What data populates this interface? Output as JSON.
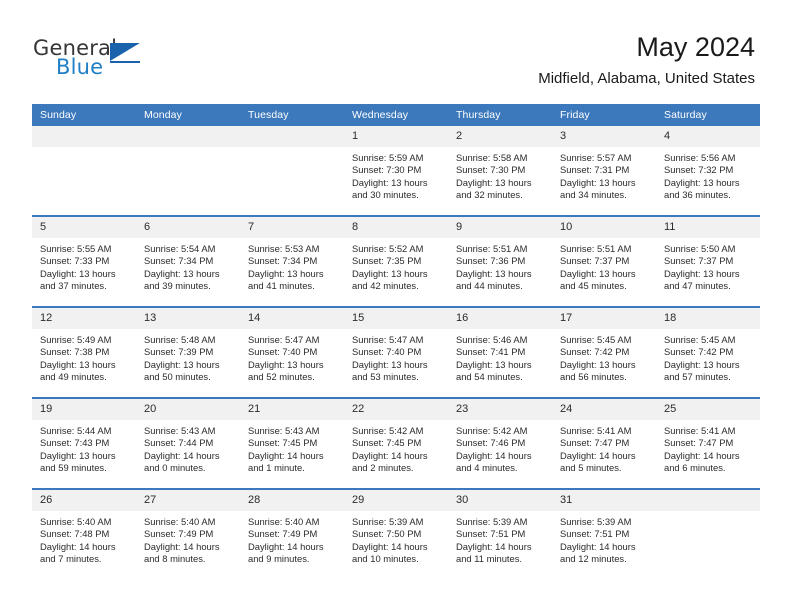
{
  "logo": {
    "word_one": "General",
    "word_two": "Blue",
    "triangle_icon": "triangle-icon",
    "accent_color": "#1b62ad"
  },
  "header": {
    "title": "May 2024",
    "subtitle": "Midfield, Alabama, United States"
  },
  "theme": {
    "header_blue": "#3c78bc",
    "daynum_gray": "#f1f1f1"
  },
  "calendar": {
    "weekday_headers": [
      "Sunday",
      "Monday",
      "Tuesday",
      "Wednesday",
      "Thursday",
      "Friday",
      "Saturday"
    ],
    "labels": {
      "sunrise": "Sunrise:",
      "sunset": "Sunset:",
      "daylight": "Daylight:"
    },
    "weeks": [
      [
        {
          "day": "",
          "blank": true,
          "sunrise": "",
          "sunset": "",
          "daylight_line1": "",
          "daylight_line2": ""
        },
        {
          "day": "",
          "blank": true,
          "sunrise": "",
          "sunset": "",
          "daylight_line1": "",
          "daylight_line2": ""
        },
        {
          "day": "",
          "blank": true,
          "sunrise": "",
          "sunset": "",
          "daylight_line1": "",
          "daylight_line2": ""
        },
        {
          "day": "1",
          "sunrise": "Sunrise: 5:59 AM",
          "sunset": "Sunset: 7:30 PM",
          "daylight_line1": "Daylight: 13 hours",
          "daylight_line2": "and 30 minutes."
        },
        {
          "day": "2",
          "sunrise": "Sunrise: 5:58 AM",
          "sunset": "Sunset: 7:30 PM",
          "daylight_line1": "Daylight: 13 hours",
          "daylight_line2": "and 32 minutes."
        },
        {
          "day": "3",
          "sunrise": "Sunrise: 5:57 AM",
          "sunset": "Sunset: 7:31 PM",
          "daylight_line1": "Daylight: 13 hours",
          "daylight_line2": "and 34 minutes."
        },
        {
          "day": "4",
          "sunrise": "Sunrise: 5:56 AM",
          "sunset": "Sunset: 7:32 PM",
          "daylight_line1": "Daylight: 13 hours",
          "daylight_line2": "and 36 minutes."
        }
      ],
      [
        {
          "day": "5",
          "sunrise": "Sunrise: 5:55 AM",
          "sunset": "Sunset: 7:33 PM",
          "daylight_line1": "Daylight: 13 hours",
          "daylight_line2": "and 37 minutes."
        },
        {
          "day": "6",
          "sunrise": "Sunrise: 5:54 AM",
          "sunset": "Sunset: 7:34 PM",
          "daylight_line1": "Daylight: 13 hours",
          "daylight_line2": "and 39 minutes."
        },
        {
          "day": "7",
          "sunrise": "Sunrise: 5:53 AM",
          "sunset": "Sunset: 7:34 PM",
          "daylight_line1": "Daylight: 13 hours",
          "daylight_line2": "and 41 minutes."
        },
        {
          "day": "8",
          "sunrise": "Sunrise: 5:52 AM",
          "sunset": "Sunset: 7:35 PM",
          "daylight_line1": "Daylight: 13 hours",
          "daylight_line2": "and 42 minutes."
        },
        {
          "day": "9",
          "sunrise": "Sunrise: 5:51 AM",
          "sunset": "Sunset: 7:36 PM",
          "daylight_line1": "Daylight: 13 hours",
          "daylight_line2": "and 44 minutes."
        },
        {
          "day": "10",
          "sunrise": "Sunrise: 5:51 AM",
          "sunset": "Sunset: 7:37 PM",
          "daylight_line1": "Daylight: 13 hours",
          "daylight_line2": "and 45 minutes."
        },
        {
          "day": "11",
          "sunrise": "Sunrise: 5:50 AM",
          "sunset": "Sunset: 7:37 PM",
          "daylight_line1": "Daylight: 13 hours",
          "daylight_line2": "and 47 minutes."
        }
      ],
      [
        {
          "day": "12",
          "sunrise": "Sunrise: 5:49 AM",
          "sunset": "Sunset: 7:38 PM",
          "daylight_line1": "Daylight: 13 hours",
          "daylight_line2": "and 49 minutes."
        },
        {
          "day": "13",
          "sunrise": "Sunrise: 5:48 AM",
          "sunset": "Sunset: 7:39 PM",
          "daylight_line1": "Daylight: 13 hours",
          "daylight_line2": "and 50 minutes."
        },
        {
          "day": "14",
          "sunrise": "Sunrise: 5:47 AM",
          "sunset": "Sunset: 7:40 PM",
          "daylight_line1": "Daylight: 13 hours",
          "daylight_line2": "and 52 minutes."
        },
        {
          "day": "15",
          "sunrise": "Sunrise: 5:47 AM",
          "sunset": "Sunset: 7:40 PM",
          "daylight_line1": "Daylight: 13 hours",
          "daylight_line2": "and 53 minutes."
        },
        {
          "day": "16",
          "sunrise": "Sunrise: 5:46 AM",
          "sunset": "Sunset: 7:41 PM",
          "daylight_line1": "Daylight: 13 hours",
          "daylight_line2": "and 54 minutes."
        },
        {
          "day": "17",
          "sunrise": "Sunrise: 5:45 AM",
          "sunset": "Sunset: 7:42 PM",
          "daylight_line1": "Daylight: 13 hours",
          "daylight_line2": "and 56 minutes."
        },
        {
          "day": "18",
          "sunrise": "Sunrise: 5:45 AM",
          "sunset": "Sunset: 7:42 PM",
          "daylight_line1": "Daylight: 13 hours",
          "daylight_line2": "and 57 minutes."
        }
      ],
      [
        {
          "day": "19",
          "sunrise": "Sunrise: 5:44 AM",
          "sunset": "Sunset: 7:43 PM",
          "daylight_line1": "Daylight: 13 hours",
          "daylight_line2": "and 59 minutes."
        },
        {
          "day": "20",
          "sunrise": "Sunrise: 5:43 AM",
          "sunset": "Sunset: 7:44 PM",
          "daylight_line1": "Daylight: 14 hours",
          "daylight_line2": "and 0 minutes."
        },
        {
          "day": "21",
          "sunrise": "Sunrise: 5:43 AM",
          "sunset": "Sunset: 7:45 PM",
          "daylight_line1": "Daylight: 14 hours",
          "daylight_line2": "and 1 minute."
        },
        {
          "day": "22",
          "sunrise": "Sunrise: 5:42 AM",
          "sunset": "Sunset: 7:45 PM",
          "daylight_line1": "Daylight: 14 hours",
          "daylight_line2": "and 2 minutes."
        },
        {
          "day": "23",
          "sunrise": "Sunrise: 5:42 AM",
          "sunset": "Sunset: 7:46 PM",
          "daylight_line1": "Daylight: 14 hours",
          "daylight_line2": "and 4 minutes."
        },
        {
          "day": "24",
          "sunrise": "Sunrise: 5:41 AM",
          "sunset": "Sunset: 7:47 PM",
          "daylight_line1": "Daylight: 14 hours",
          "daylight_line2": "and 5 minutes."
        },
        {
          "day": "25",
          "sunrise": "Sunrise: 5:41 AM",
          "sunset": "Sunset: 7:47 PM",
          "daylight_line1": "Daylight: 14 hours",
          "daylight_line2": "and 6 minutes."
        }
      ],
      [
        {
          "day": "26",
          "sunrise": "Sunrise: 5:40 AM",
          "sunset": "Sunset: 7:48 PM",
          "daylight_line1": "Daylight: 14 hours",
          "daylight_line2": "and 7 minutes."
        },
        {
          "day": "27",
          "sunrise": "Sunrise: 5:40 AM",
          "sunset": "Sunset: 7:49 PM",
          "daylight_line1": "Daylight: 14 hours",
          "daylight_line2": "and 8 minutes."
        },
        {
          "day": "28",
          "sunrise": "Sunrise: 5:40 AM",
          "sunset": "Sunset: 7:49 PM",
          "daylight_line1": "Daylight: 14 hours",
          "daylight_line2": "and 9 minutes."
        },
        {
          "day": "29",
          "sunrise": "Sunrise: 5:39 AM",
          "sunset": "Sunset: 7:50 PM",
          "daylight_line1": "Daylight: 14 hours",
          "daylight_line2": "and 10 minutes."
        },
        {
          "day": "30",
          "sunrise": "Sunrise: 5:39 AM",
          "sunset": "Sunset: 7:51 PM",
          "daylight_line1": "Daylight: 14 hours",
          "daylight_line2": "and 11 minutes."
        },
        {
          "day": "31",
          "sunrise": "Sunrise: 5:39 AM",
          "sunset": "Sunset: 7:51 PM",
          "daylight_line1": "Daylight: 14 hours",
          "daylight_line2": "and 12 minutes."
        },
        {
          "day": "",
          "blank": true,
          "sunrise": "",
          "sunset": "",
          "daylight_line1": "",
          "daylight_line2": ""
        }
      ]
    ]
  }
}
